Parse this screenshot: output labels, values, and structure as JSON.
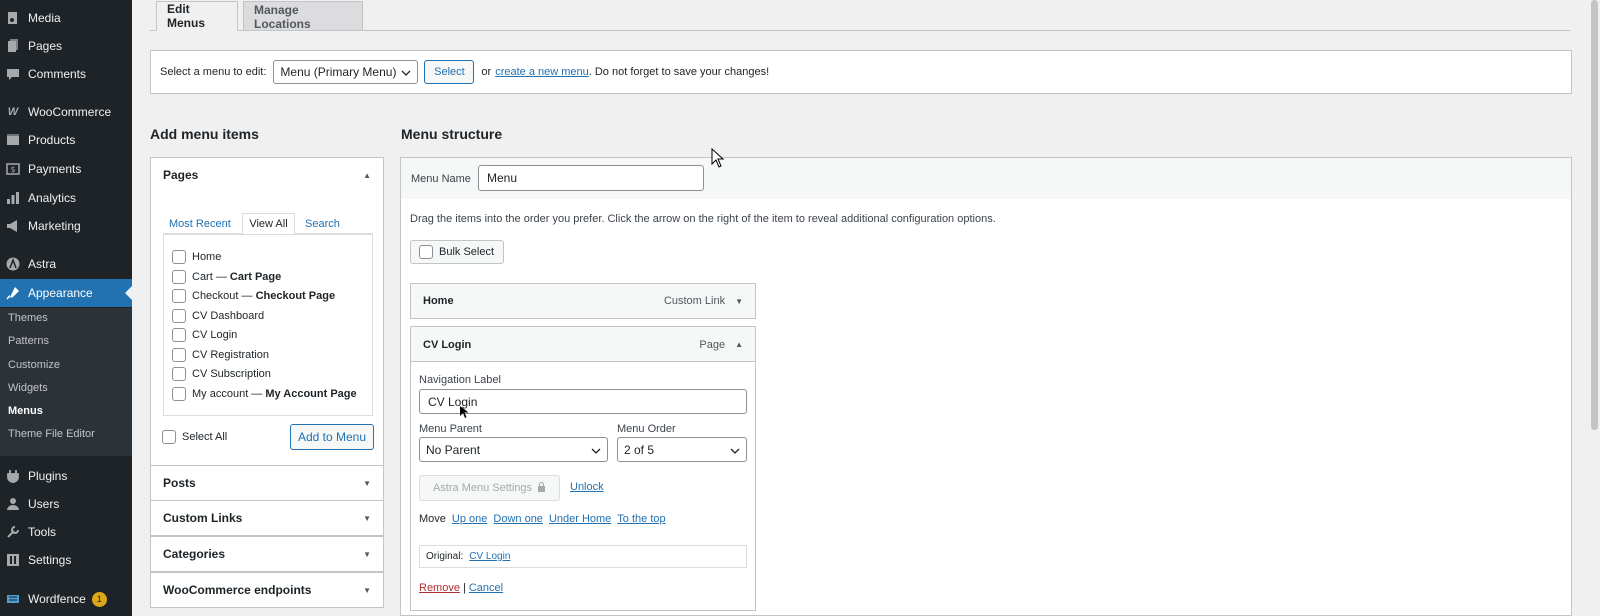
{
  "sidebar": {
    "items": [
      {
        "label": "Media",
        "icon": "media-icon"
      },
      {
        "label": "Pages",
        "icon": "pages-icon"
      },
      {
        "label": "Comments",
        "icon": "comments-icon"
      },
      {
        "label": "WooCommerce",
        "icon": "woocommerce-icon"
      },
      {
        "label": "Products",
        "icon": "products-icon"
      },
      {
        "label": "Payments",
        "icon": "payments-icon"
      },
      {
        "label": "Analytics",
        "icon": "analytics-icon"
      },
      {
        "label": "Marketing",
        "icon": "marketing-icon"
      },
      {
        "label": "Astra",
        "icon": "astra-icon"
      },
      {
        "label": "Appearance",
        "icon": "appearance-icon"
      },
      {
        "label": "Plugins",
        "icon": "plugins-icon"
      },
      {
        "label": "Users",
        "icon": "users-icon"
      },
      {
        "label": "Tools",
        "icon": "tools-icon"
      },
      {
        "label": "Settings",
        "icon": "settings-icon"
      },
      {
        "label": "Wordfence",
        "icon": "wordfence-icon",
        "badge": "1"
      }
    ],
    "submenu": [
      "Themes",
      "Patterns",
      "Customize",
      "Widgets",
      "Menus",
      "Theme File Editor"
    ]
  },
  "tabs": {
    "edit": "Edit Menus",
    "manage": "Manage Locations"
  },
  "select_bar": {
    "label": "Select a menu to edit:",
    "selected_menu": "Menu (Primary Menu)",
    "select_button": "Select",
    "or_text": "or",
    "create_link": "create a new menu",
    "reminder": ". Do not forget to save your changes!"
  },
  "add_items": {
    "heading": "Add menu items",
    "pages": {
      "title": "Pages",
      "tabs": [
        "Most Recent",
        "View All",
        "Search"
      ],
      "items": [
        {
          "label": "Home",
          "suffix": ""
        },
        {
          "label": "Cart — ",
          "suffix": "Cart Page"
        },
        {
          "label": "Checkout — ",
          "suffix": "Checkout Page"
        },
        {
          "label": "CV Dashboard",
          "suffix": ""
        },
        {
          "label": "CV Login",
          "suffix": ""
        },
        {
          "label": "CV Registration",
          "suffix": ""
        },
        {
          "label": "CV Subscription",
          "suffix": ""
        },
        {
          "label": "My account — ",
          "suffix": "My Account Page"
        }
      ],
      "select_all": "Select All",
      "add_button": "Add to Menu"
    },
    "sections": [
      "Posts",
      "Custom Links",
      "Categories",
      "WooCommerce endpoints"
    ]
  },
  "structure": {
    "heading": "Menu structure",
    "menu_name_label": "Menu Name",
    "menu_name_value": "Menu",
    "instructions": "Drag the items into the order you prefer. Click the arrow on the right of the item to reveal additional configuration options.",
    "bulk_select": "Bulk Select",
    "home_item": {
      "title": "Home",
      "type": "Custom Link"
    },
    "cv_item": {
      "title": "CV Login",
      "type": "Page",
      "nav_label": "Navigation Label",
      "nav_value": "CV Login",
      "parent_label": "Menu Parent",
      "parent_value": "No Parent",
      "order_label": "Menu Order",
      "order_value": "2 of 5",
      "astra_button": "Astra Menu Settings",
      "unlock": "Unlock",
      "move_label": "Move",
      "move_links": [
        "Up one",
        "Down one",
        "Under Home",
        "To the top"
      ],
      "original_label": "Original:",
      "original_link": "CV Login",
      "remove": "Remove",
      "separator": "|",
      "cancel": "Cancel"
    }
  },
  "colors": {
    "admin_bar": "#1d2327",
    "accent": "#2271b1",
    "remove": "#b32d2e",
    "badge": "#dba617"
  }
}
